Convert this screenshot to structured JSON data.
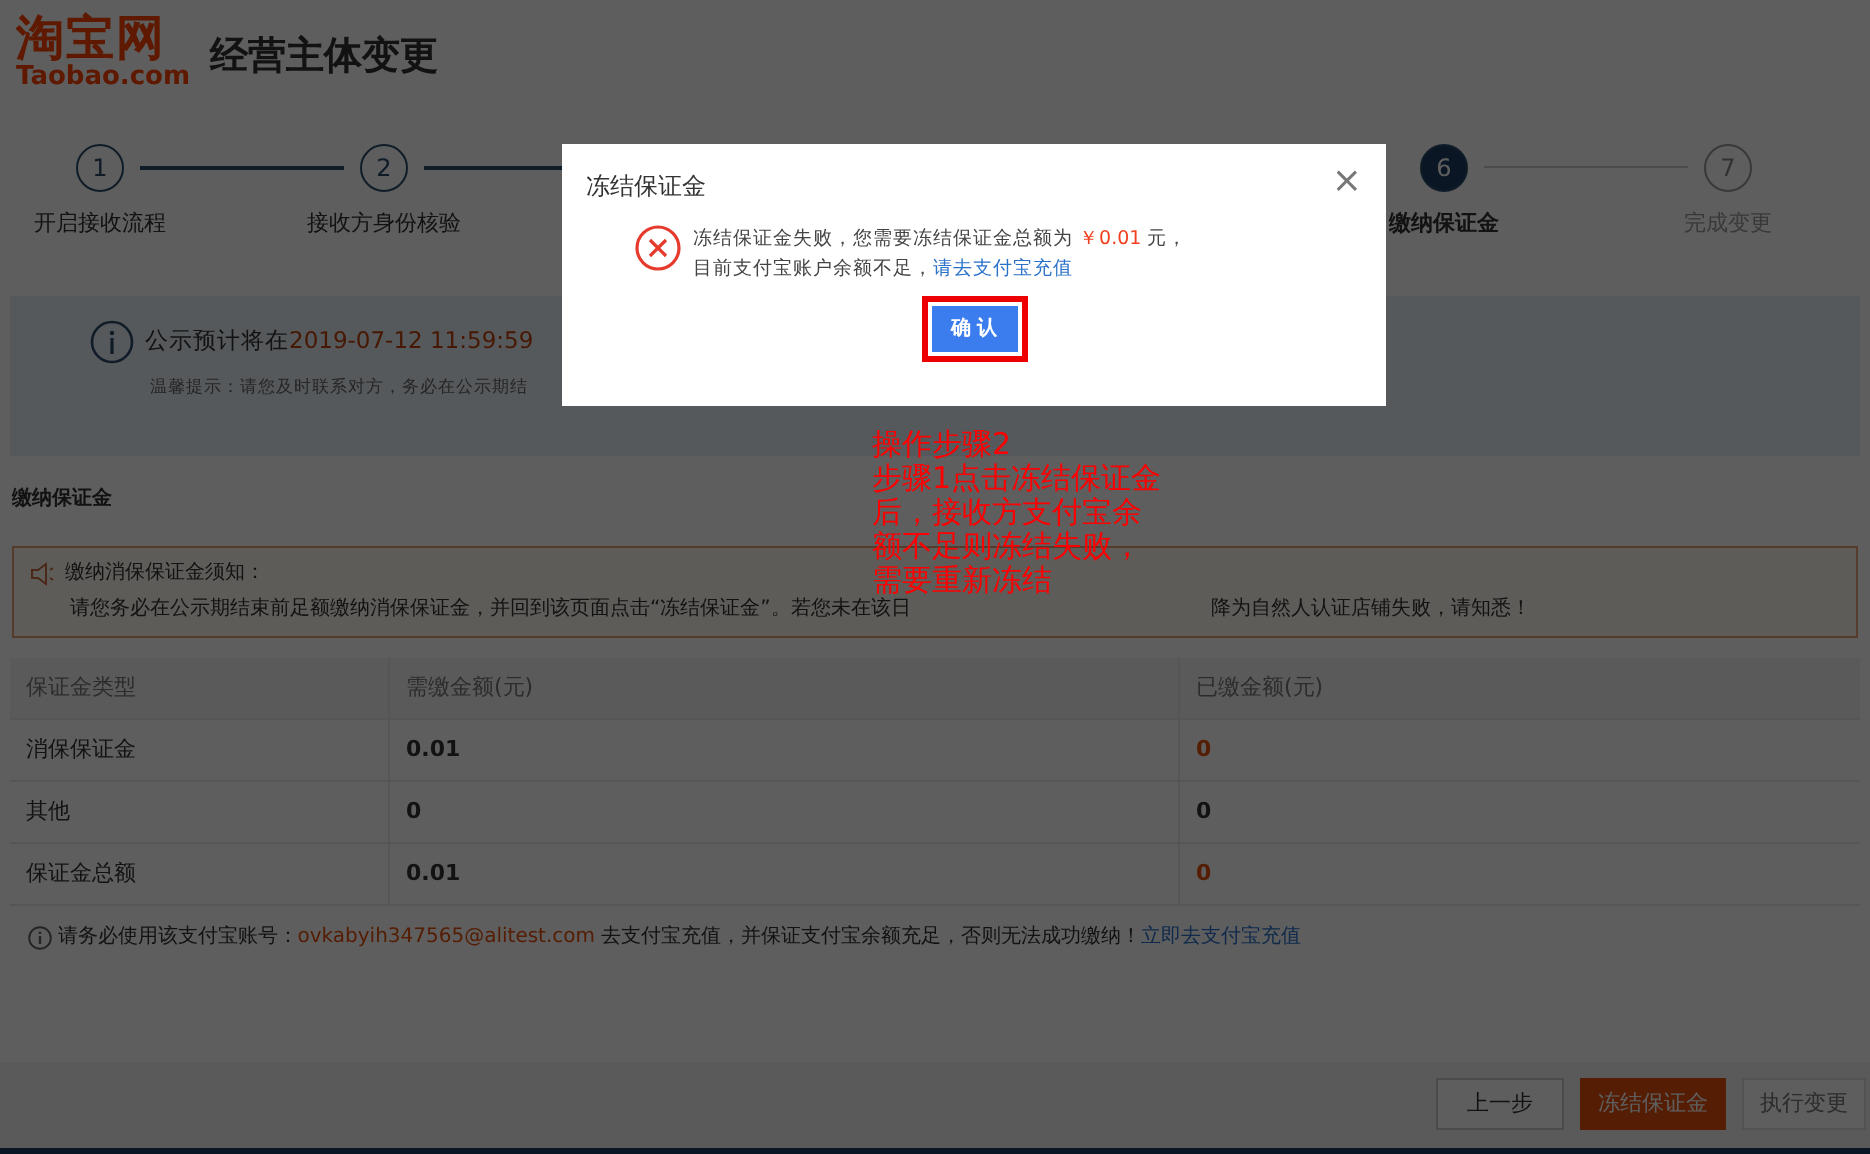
{
  "header": {
    "logo_cn": "淘宝网",
    "logo_en": "Taobao.com",
    "title": "经营主体变更"
  },
  "steps": [
    {
      "number": "1",
      "label": "开启接收流程",
      "completed": true,
      "selected": false
    },
    {
      "number": "2",
      "label": "接收方身份核验",
      "completed": true,
      "selected": false
    },
    {
      "number": "6",
      "label": "缴纳保证金",
      "completed": false,
      "selected": true
    },
    {
      "number": "7",
      "label": "完成变更",
      "completed": false,
      "selected": false
    }
  ],
  "banner": {
    "prefix": "公示预计将在",
    "date": "2019-07-12 11:59:59",
    "tip": "温馨提示：请您及时联系对方，务必在公示期结"
  },
  "section_title": "缴纳保证金",
  "notice": {
    "title": "缴纳消保保证金须知：",
    "line_start": "请您务必在公示期结束前足额缴纳消保保证金，并回到该页面点击“冻结保证金”。若您未在该日",
    "line_end": "降为自然人认证店铺失败，请知悉！"
  },
  "table": {
    "columns": [
      "保证金类型",
      "需缴金额(元)",
      "已缴金额(元)"
    ],
    "rows": [
      {
        "type": "消保保证金",
        "due": "0.01",
        "paid": "0",
        "unpaid": true
      },
      {
        "type": "其他",
        "due": "0",
        "paid": "0",
        "unpaid": false
      },
      {
        "type": "保证金总额",
        "due": "0.01",
        "paid": "0",
        "unpaid": true
      }
    ]
  },
  "footer_note": {
    "prefix": "请务必使用该支付宝账号：",
    "account": "ovkabyih347565@alitest.com",
    "middle": "去支付宝充值，并保证支付宝余额充足，否则无法成功缴纳！",
    "link": "立即去支付宝充值"
  },
  "actions": [
    {
      "label": "上一步",
      "kind": "default"
    },
    {
      "label": "冻结保证金",
      "kind": "primary"
    },
    {
      "label": "执行变更",
      "kind": "disabled"
    }
  ],
  "dialog": {
    "title": "冻结保证金",
    "close": "×",
    "message_prefix": "冻结保证金失败，您需要冻结保证金总额为",
    "amount": "￥0.01",
    "message_suffix": "元，",
    "line2": "目前支付宝账户余额不足，",
    "link": "请去支付宝充值",
    "confirm": "确 认",
    "highlighted": true
  },
  "annotation": {
    "lines": [
      "操作步骤2",
      "步骤1点击冻结保证金",
      "后，接收方支付宝余",
      "额不足则冻结失败，",
      "需要重新冻结"
    ]
  }
}
